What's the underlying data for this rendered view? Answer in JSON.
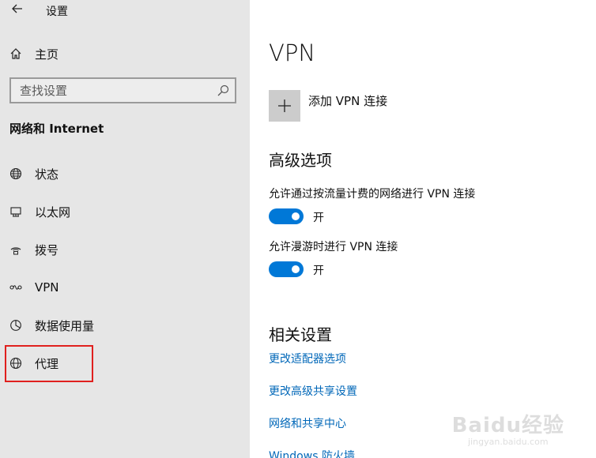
{
  "app": {
    "title": "设置"
  },
  "sidebar": {
    "home_label": "主页",
    "search_placeholder": "查找设置",
    "section_title": "网络和 Internet",
    "items": [
      {
        "label": "状态",
        "icon": "globe-status-icon"
      },
      {
        "label": "以太网",
        "icon": "ethernet-icon"
      },
      {
        "label": "拨号",
        "icon": "dial-up-icon"
      },
      {
        "label": "VPN",
        "icon": "vpn-icon"
      },
      {
        "label": "数据使用量",
        "icon": "data-usage-icon"
      },
      {
        "label": "代理",
        "icon": "globe-icon"
      }
    ],
    "highlighted_item": "代理"
  },
  "main": {
    "title": "VPN",
    "add_vpn_label": "添加 VPN 连接",
    "advanced_title": "高级选项",
    "settings": [
      {
        "label": "允许通过按流量计费的网络进行 VPN 连接",
        "state": "开",
        "on": true
      },
      {
        "label": "允许漫游时进行 VPN 连接",
        "state": "开",
        "on": true
      }
    ],
    "related_title": "相关设置",
    "links": [
      "更改适配器选项",
      "更改高级共享设置",
      "网络和共享中心",
      "Windows 防火墙"
    ]
  },
  "watermark": {
    "logo": "Baidu经验",
    "url": "jingyan.baidu.com"
  },
  "colors": {
    "accent": "#0078d7",
    "link": "#0067b8",
    "sidebar_bg": "#e6e6e6",
    "highlight": "#e0201e"
  }
}
